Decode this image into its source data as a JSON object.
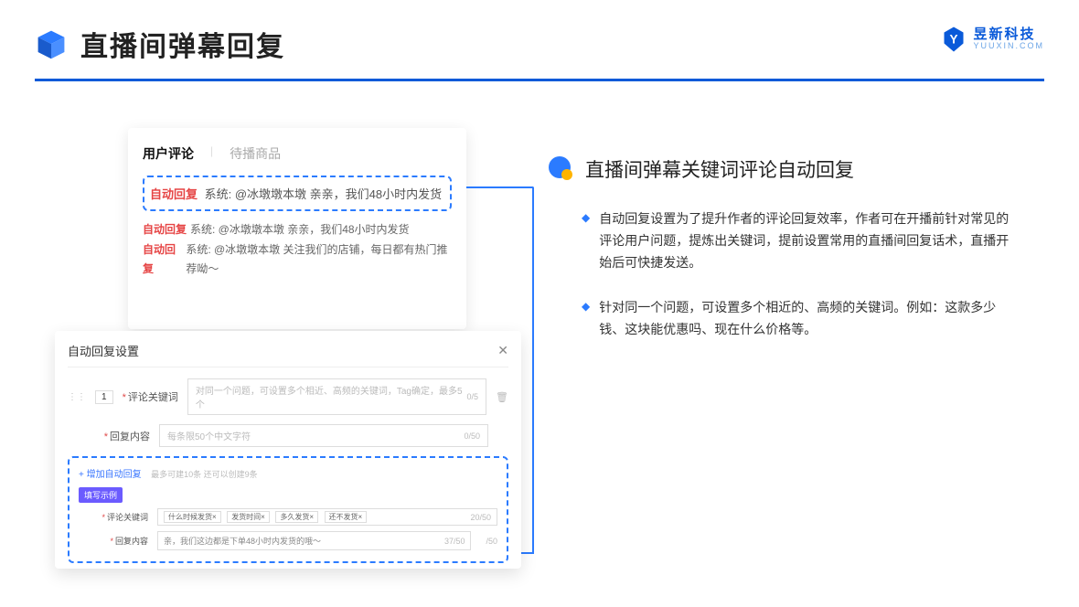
{
  "header": {
    "title": "直播间弹幕回复"
  },
  "brand": {
    "name": "昱新科技",
    "sub": "YUUXIN.COM"
  },
  "panelA": {
    "tab_active": "用户评论",
    "tab_inactive": "待播商品",
    "chip": "自动回复",
    "hl": "系统: @冰墩墩本墩 亲亲，我们48小时内发货",
    "l2": "系统: @冰墩墩本墩 亲亲，我们48小时内发货",
    "l3": "系统: @冰墩墩本墩 关注我们的店铺，每日都有热门推荐呦～"
  },
  "panelB": {
    "title": "自动回复设置",
    "num": "1",
    "lab_keyword": "评论关键词",
    "ph_keyword": "对同一个问题，可设置多个相近、高频的关键词，Tag确定，最多5个",
    "cnt_keyword": "0/5",
    "lab_reply": "回复内容",
    "ph_reply": "每条限50个中文字符",
    "cnt_reply": "0/50",
    "addlink": "+ 增加自动回复",
    "addmeta": "最多可建10条 还可以创建9条",
    "pill": "填写示例",
    "ex_lab_keyword": "评论关键词",
    "ex_tags": [
      "什么时候发货×",
      "发货时间×",
      "多久发货×",
      "还不发货×"
    ],
    "ex_cnt_k": "20/50",
    "ex_lab_reply": "回复内容",
    "ex_reply": "亲，我们这边都是下单48小时内发货的哦～",
    "ex_cnt_r": "37/50",
    "ex_out": "/50"
  },
  "right": {
    "title": "直播间弹幕关键词评论自动回复",
    "b1": "自动回复设置为了提升作者的评论回复效率，作者可在开播前针对常见的评论用户问题，提炼出关键词，提前设置常用的直播间回复话术，直播开始后可快捷发送。",
    "b2": "针对同一个问题，可设置多个相近的、高频的关键词。例如：这款多少钱、这块能优惠吗、现在什么价格等。"
  }
}
